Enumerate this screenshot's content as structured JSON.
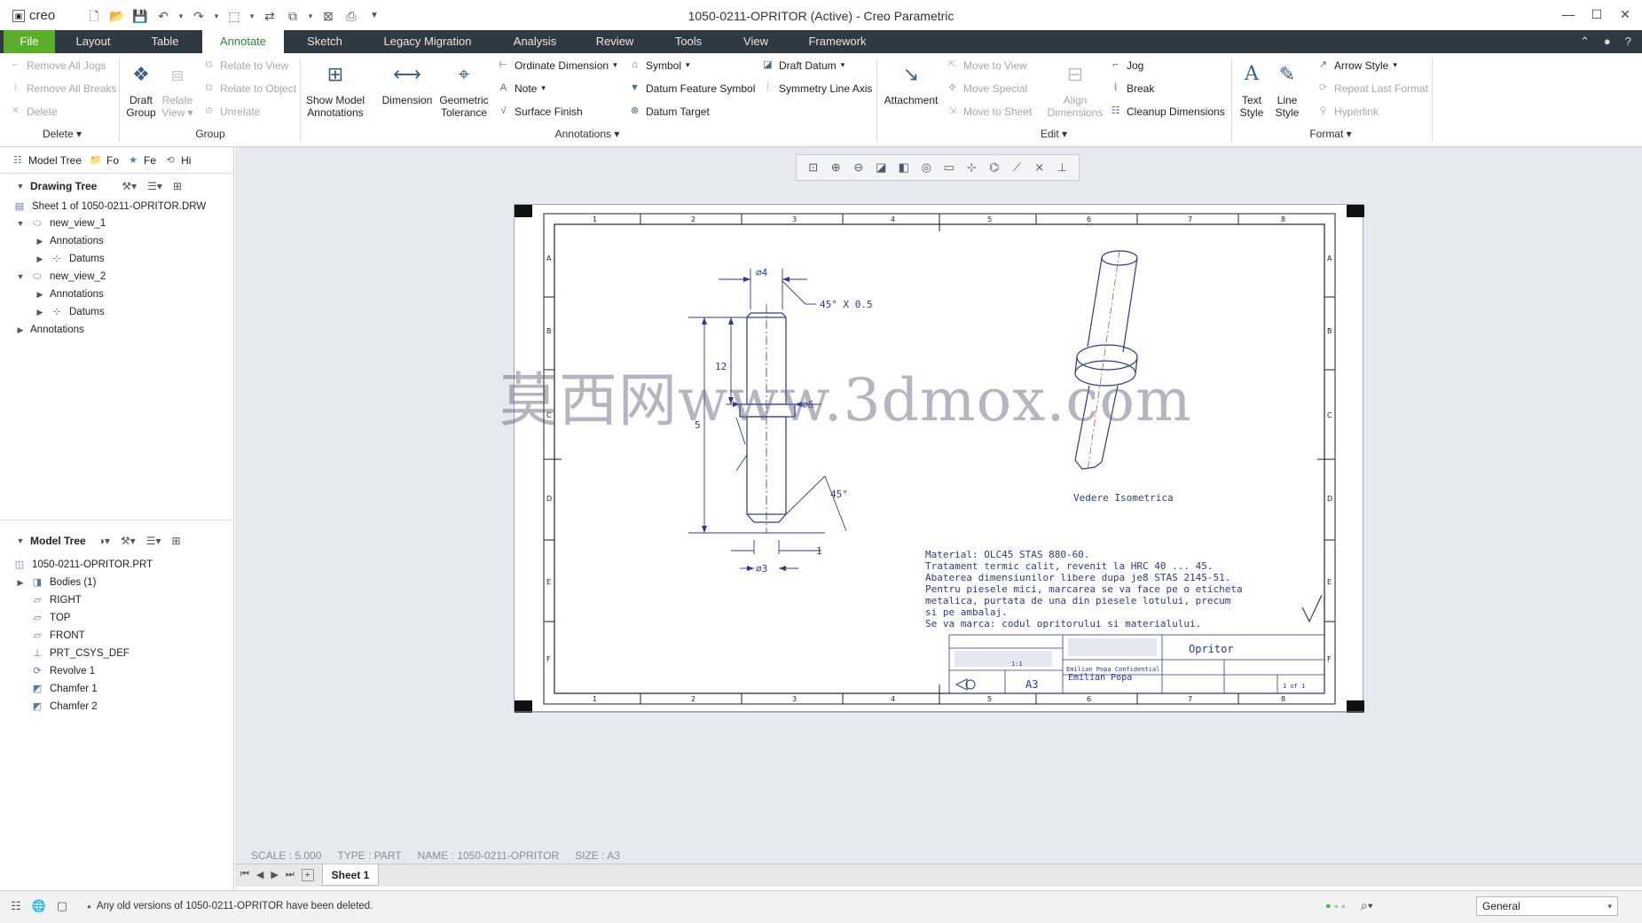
{
  "app": {
    "logo": "creo",
    "title": "1050-0211-OPRITOR (Active) - Creo Parametric",
    "window_controls": [
      "minimize-icon",
      "maximize-icon",
      "close-icon"
    ]
  },
  "tabs": [
    "File",
    "Layout",
    "Table",
    "Annotate",
    "Sketch",
    "Legacy Migration",
    "Analysis",
    "Review",
    "Tools",
    "View",
    "Framework"
  ],
  "ribbon": {
    "delete": {
      "remove_jogs": "Remove All Jogs",
      "remove_breaks": "Remove All Breaks",
      "delete": "Delete",
      "group_label": "Delete"
    },
    "group": {
      "draft_group": "Draft Group",
      "relate_view": "Relate View",
      "relate_to_view": "Relate to View",
      "relate_to_object": "Relate to Object",
      "unrelate": "Unrelate",
      "group_label": "Group"
    },
    "annotations": {
      "show_model": "Show Model Annotations",
      "dimension": "Dimension",
      "geometric_tolerance": "Geometric Tolerance",
      "ordinate": "Ordinate Dimension",
      "note": "Note",
      "surface_finish": "Surface Finish",
      "symbol": "Symbol",
      "datum_feature": "Datum Feature Symbol",
      "datum_target": "Datum Target",
      "draft_datum": "Draft Datum",
      "symmetry": "Symmetry Line Axis",
      "group_label": "Annotations"
    },
    "edit": {
      "attachment": "Attachment",
      "move_to_view": "Move to View",
      "move_special": "Move Special",
      "move_to_sheet": "Move to Sheet",
      "align": "Align Dimensions",
      "jog": "Jog",
      "break": "Break",
      "cleanup": "Cleanup Dimensions",
      "group_label": "Edit"
    },
    "format": {
      "text_style": "Text Style",
      "line_style": "Line Style",
      "arrow_style": "Arrow Style",
      "repeat": "Repeat Last Format",
      "hyperlink": "Hyperlink",
      "group_label": "Format"
    }
  },
  "left_panel": {
    "tabs": [
      "Model Tree",
      "Fo",
      "Fe",
      "Hi"
    ],
    "drawing_tree": {
      "title": "Drawing Tree",
      "items": [
        {
          "label": "Sheet 1 of 1050-0211-OPRITOR.DRW"
        },
        {
          "label": "new_view_1"
        },
        {
          "label": "Annotations"
        },
        {
          "label": "Datums"
        },
        {
          "label": "new_view_2"
        },
        {
          "label": "Annotations"
        },
        {
          "label": "Datums"
        },
        {
          "label": "Annotations"
        }
      ]
    },
    "model_tree": {
      "title": "Model Tree",
      "items": [
        {
          "label": "1050-0211-OPRITOR.PRT"
        },
        {
          "label": "Bodies (1)"
        },
        {
          "label": "RIGHT"
        },
        {
          "label": "TOP"
        },
        {
          "label": "FRONT"
        },
        {
          "label": "PRT_CSYS_DEF"
        },
        {
          "label": "Revolve 1"
        },
        {
          "label": "Chamfer 1"
        },
        {
          "label": "Chamfer 2"
        }
      ]
    }
  },
  "drawing": {
    "col_labels": [
      "1",
      "2",
      "3",
      "4",
      "5",
      "6",
      "7",
      "8"
    ],
    "row_labels": [
      "A",
      "B",
      "C",
      "D",
      "E",
      "F"
    ],
    "dims": {
      "d4": "⌀4",
      "chamfer": "45° X 0.5",
      "h12": "12",
      "h5": "5",
      "d6": "⌀6",
      "angle": "45°",
      "one": "1",
      "d3": "⌀3"
    },
    "iso_label": "Vedere Isometrica",
    "notes": [
      "Material: OLC45 STAS 880-60.",
      "Tratament termic calit, revenit la HRC 40 ... 45.",
      "Abaterea dimensiunilor libere dupa je8 STAS 2145-51.",
      "Pentru piesele mici, marcarea se va face pe o eticheta",
      "metalica, purtata de una din piesele lotului, precum",
      "si pe ambalaj.",
      "Se va marca: codul opritorului si materialului."
    ],
    "title_block": {
      "part_name": "Opritor",
      "size": "A3",
      "scale": "1:1",
      "author": "Emilian Popa",
      "confidential": "Emilian Popa Confidential",
      "sheet": "1 of 1"
    }
  },
  "watermark": "莫西网www.3dmox.com",
  "status_info": {
    "scale": "SCALE : 5.000",
    "type": "TYPE : PART",
    "name": "NAME : 1050-0211-OPRITOR",
    "size": "SIZE : A3"
  },
  "sheet_tab": "Sheet 1",
  "message": "Any old versions of 1050-0211-OPRITOR have been deleted.",
  "filter": "General"
}
